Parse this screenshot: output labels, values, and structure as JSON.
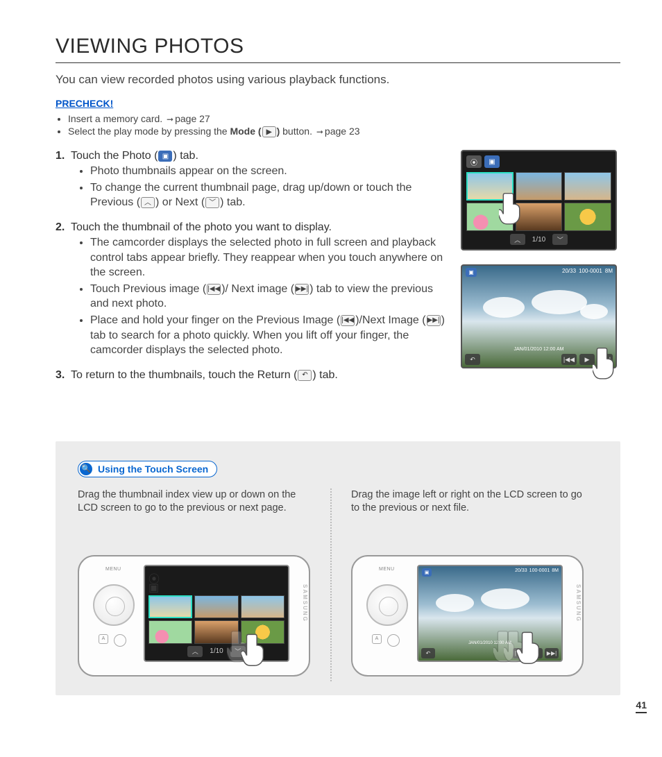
{
  "title": "VIEWING PHOTOS",
  "intro": "You can view recorded photos using various playback functions.",
  "precheck_label": "PRECHECK!",
  "precheck": {
    "item1_a": "Insert a memory card. ",
    "item1_b": "page 27",
    "item2_a": "Select the play mode by pressing the ",
    "item2_b": "Mode (",
    "item2_c": ")",
    "item2_d": " button. ",
    "item2_e": "page 23"
  },
  "icons": {
    "photo_tab": "▣",
    "mode_play": "▶",
    "prev": "︿",
    "next": "﹀",
    "prev_img": "|◀◀",
    "next_img": "▶▶|",
    "return": "↶",
    "play": "▶",
    "video_tab": "⦿"
  },
  "steps": {
    "s1_a": "Touch the Photo (",
    "s1_b": ") tab.",
    "s1_bullets": {
      "b1": "Photo thumbnails appear on the screen.",
      "b2_a": "To change the current thumbnail page, drag up/down or touch the Previous (",
      "b2_b": ") or Next (",
      "b2_c": ") tab."
    },
    "s2": "Touch the thumbnail of the photo you want to display.",
    "s2_bullets": {
      "b1": "The camcorder displays the selected photo in full screen and playback control tabs appear briefly. They reappear when you touch anywhere on the screen.",
      "b2_a": "Touch Previous image (",
      "b2_b": ")/ Next image (",
      "b2_c": ") tab to view the previous and next photo.",
      "b3_a": "Place and hold your finger on the Previous Image (",
      "b3_b": ")/Next Image (",
      "b3_c": ") tab to search for a photo quickly. When you lift off your finger, the camcorder displays the selected photo."
    },
    "s3_a": "To return to the thumbnails, touch the Return (",
    "s3_b": ") tab."
  },
  "fig1": {
    "pager": "1/10"
  },
  "fig2": {
    "counter": "20/33",
    "fileno": "100-0001",
    "res": "8M",
    "datetime": "JAN/01/2010  12:00 AM"
  },
  "tip": {
    "badge": "Using the Touch Screen",
    "left": "Drag the thumbnail index view up or down on the LCD screen to go to the previous or next page.",
    "right": "Drag the image left or right on the LCD screen to go to the previous or next file.",
    "dev_pager": "1/10",
    "brand": "SAMSUNG",
    "menu_label": "MENU",
    "a_label": "A",
    "dev2_counter": "20/33",
    "dev2_fileno": "100-0001",
    "dev2_res": "8M",
    "dev2_datetime": "JAN/01/2010  12:00 AM"
  },
  "page_number": "41"
}
